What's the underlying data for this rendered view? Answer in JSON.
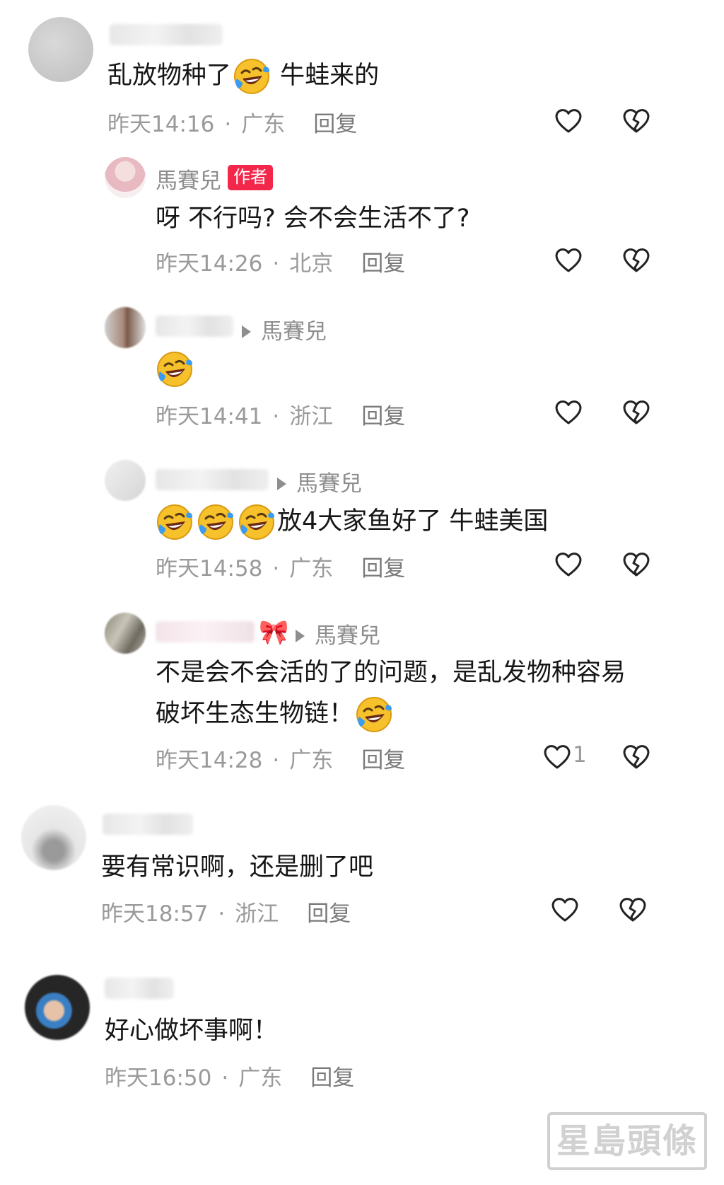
{
  "comments": [
    {
      "text_before": "乱放物种了",
      "text_after": " 牛蛙来的",
      "time": "昨天14:16",
      "location": "广东",
      "reply": "回复"
    },
    {
      "user": "馬賽兒",
      "badge": "作者",
      "text": "呀 不行吗? 会不会生活不了?",
      "time": "昨天14:26",
      "location": "北京",
      "reply": "回复"
    },
    {
      "reply_to": "馬賽兒",
      "time": "昨天14:41",
      "location": "浙江",
      "reply": "回复"
    },
    {
      "reply_to": "馬賽兒",
      "text": "放4大家鱼好了 牛蛙美国",
      "time": "昨天14:58",
      "location": "广东",
      "reply": "回复"
    },
    {
      "reply_to": "馬賽兒",
      "text_line1": "不是会不会活的了的问题，是乱发物种容易",
      "text_line2": "破坏生态生物链！",
      "time": "昨天14:28",
      "location": "广东",
      "reply": "回复",
      "likes": "1"
    },
    {
      "text": "要有常识啊，还是删了吧",
      "time": "昨天18:57",
      "location": "浙江",
      "reply": "回复"
    },
    {
      "text": "好心做坏事啊！",
      "time": "昨天16:50",
      "location": "广东",
      "reply": "回复"
    }
  ],
  "separator": "·",
  "watermark": "星島頭條",
  "icons": {
    "like": "heart-outline-icon",
    "dislike": "broken-heart-icon",
    "emoji": "rolling-on-floor-laughing-emoji"
  }
}
